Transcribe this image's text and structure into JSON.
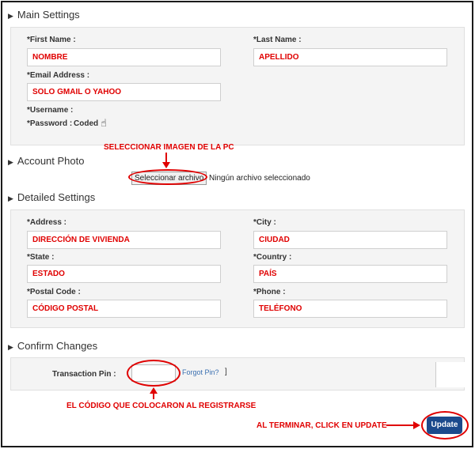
{
  "main_settings": {
    "title": "Main Settings",
    "first_name_label": "*First Name :",
    "first_name_value": "NOMBRE",
    "last_name_label": "*Last Name :",
    "last_name_value": "APELLIDO",
    "email_label": "*Email Address :",
    "email_value": "SOLO GMAIL O YAHOO",
    "username_label": "*Username :",
    "password_label": "*Password :",
    "password_value": "Coded"
  },
  "account_photo": {
    "title": "Account Photo",
    "annotation": "SELECCIONAR IMAGEN DE LA PC",
    "file_button_label": "Seleccionar archivo",
    "file_status": "Ningún archivo seleccionado"
  },
  "detailed_settings": {
    "title": "Detailed Settings",
    "address_label": "*Address :",
    "address_value": "DIRECCIÓN DE VIVIENDA",
    "city_label": "*City :",
    "city_value": "CIUDAD",
    "state_label": "*State :",
    "state_value": "ESTADO",
    "country_label": "*Country :",
    "country_value": "PAÍS",
    "postal_label": "*Postal Code :",
    "postal_value": "CÓDIGO POSTAL",
    "phone_label": "*Phone :",
    "phone_value": "TELÉFONO"
  },
  "confirm_changes": {
    "title": "Confirm Changes",
    "pin_label": "Transaction Pin :",
    "forgot_pin_label": "Forgot Pin?",
    "forgot_pin_bracket": "]",
    "pin_annotation": "EL CÓDIGO QUE COLOCARON AL REGISTRARSE",
    "update_annotation": "AL TERMINAR, CLICK EN UPDATE",
    "update_button_label": "Update"
  },
  "colors": {
    "annotation_red": "#e00000",
    "update_button": "#1c4a8c",
    "link": "#3a6fb0"
  },
  "icons": {
    "section_arrow": "triangle-right-icon",
    "cursor": "hand-pointer-icon"
  }
}
